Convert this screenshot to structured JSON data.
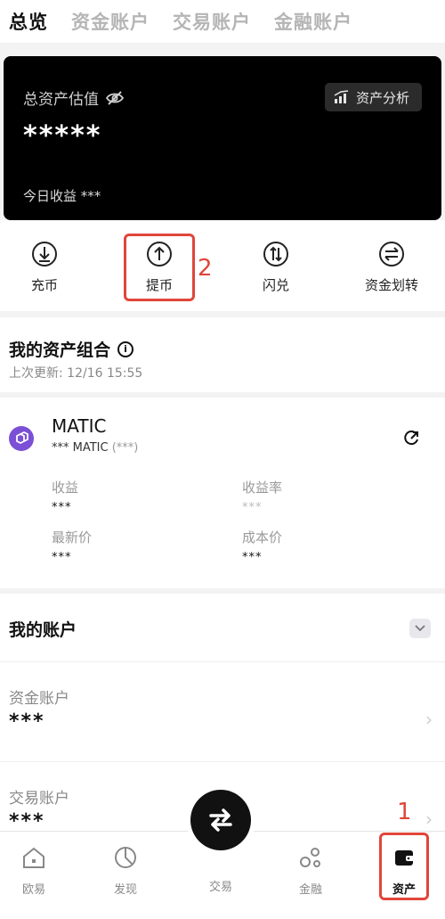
{
  "top_tabs": [
    "总览",
    "资金账户",
    "交易账户",
    "金融账户"
  ],
  "card": {
    "est_label": "总资产估值",
    "masked_total": "*****",
    "analysis_label": "资产分析",
    "today_label": "今日收益 ***"
  },
  "actions": [
    {
      "label": "充币",
      "icon": "deposit-icon"
    },
    {
      "label": "提币",
      "icon": "withdraw-icon"
    },
    {
      "label": "闪兑",
      "icon": "swap-icon"
    },
    {
      "label": "资金划转",
      "icon": "transfer-icon"
    }
  ],
  "annotations": {
    "step1": "1",
    "step2": "2",
    "highlight_color": "#e0463a"
  },
  "portfolio": {
    "title": "我的资产组合",
    "updated": "上次更新: 12/16 15:55"
  },
  "asset": {
    "name": "MATIC",
    "amount": "*** MATIC",
    "amount_paren": "(***)",
    "logo_color": "#7b4fd6",
    "metrics": [
      {
        "label": "收益",
        "value": "***"
      },
      {
        "label": "收益率",
        "value": "***"
      },
      {
        "label": "最新价",
        "value": "***"
      },
      {
        "label": "成本价",
        "value": "***"
      }
    ]
  },
  "accounts": {
    "title": "我的账户",
    "rows": [
      {
        "label": "资金账户",
        "value": "***"
      },
      {
        "label": "交易账户",
        "value": "***"
      }
    ]
  },
  "bottom_nav": [
    {
      "label": "欧易",
      "icon": "home-icon"
    },
    {
      "label": "发现",
      "icon": "discover-icon"
    },
    {
      "label": "交易",
      "icon": "trade-icon"
    },
    {
      "label": "金融",
      "icon": "finance-icon"
    },
    {
      "label": "资产",
      "icon": "wallet-icon"
    }
  ]
}
